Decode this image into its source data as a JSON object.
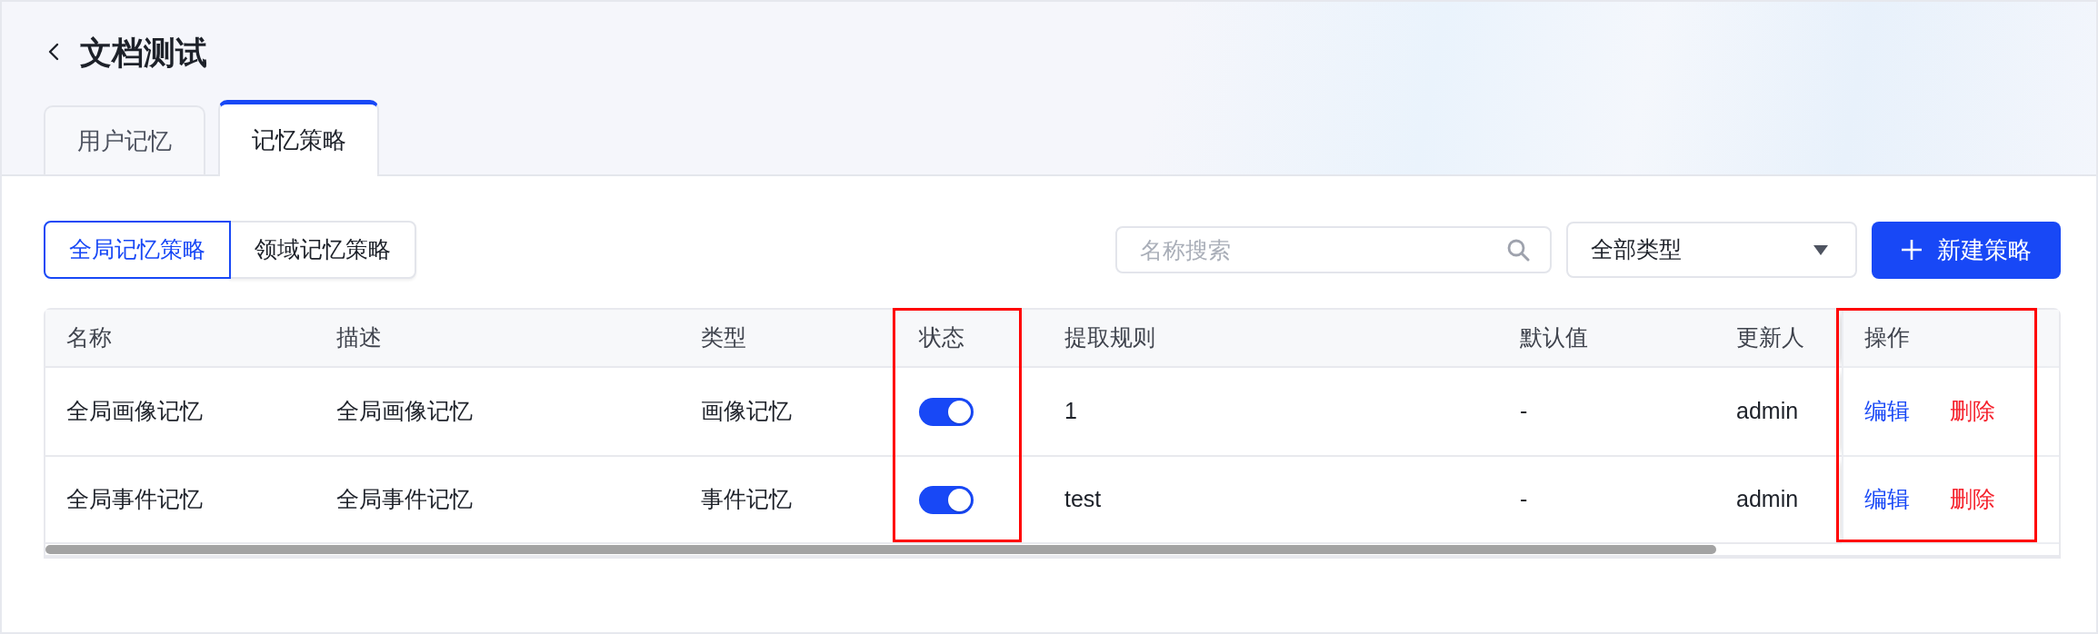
{
  "header": {
    "title": "文档测试"
  },
  "tabs": [
    {
      "label": "用户记忆",
      "selected": false
    },
    {
      "label": "记忆策略",
      "selected": true
    }
  ],
  "scope_switch": [
    {
      "label": "全局记忆策略",
      "selected": true
    },
    {
      "label": "领域记忆策略",
      "selected": false
    }
  ],
  "search": {
    "placeholder": "名称搜索"
  },
  "type_filter": {
    "value": "全部类型"
  },
  "new_button": {
    "label": "新建策略"
  },
  "table": {
    "columns": [
      {
        "label": "名称",
        "highlighted": false
      },
      {
        "label": "描述",
        "highlighted": false
      },
      {
        "label": "类型",
        "highlighted": false
      },
      {
        "label": "状态",
        "highlighted": true
      },
      {
        "label": "提取规则",
        "highlighted": false
      },
      {
        "label": "默认值",
        "highlighted": false
      },
      {
        "label": "更新人",
        "highlighted": false
      },
      {
        "label": "操作",
        "highlighted": true
      }
    ],
    "rows": [
      {
        "cells": [
          {
            "kind": "text",
            "text": "全局画像记忆"
          },
          {
            "kind": "text",
            "text": "全局画像记忆"
          },
          {
            "kind": "text",
            "text": "画像记忆"
          },
          {
            "kind": "switch",
            "on": true
          },
          {
            "kind": "text",
            "text": "1"
          },
          {
            "kind": "text",
            "text": "-"
          },
          {
            "kind": "text",
            "text": "admin"
          },
          {
            "kind": "actions",
            "actions": [
              {
                "kind": "edit",
                "label": "编辑"
              },
              {
                "kind": "delete",
                "label": "删除"
              }
            ]
          }
        ]
      },
      {
        "cells": [
          {
            "kind": "text",
            "text": "全局事件记忆"
          },
          {
            "kind": "text",
            "text": "全局事件记忆"
          },
          {
            "kind": "text",
            "text": "事件记忆"
          },
          {
            "kind": "switch",
            "on": true
          },
          {
            "kind": "text",
            "text": "test"
          },
          {
            "kind": "text",
            "text": "-"
          },
          {
            "kind": "text",
            "text": "admin"
          },
          {
            "kind": "actions",
            "actions": [
              {
                "kind": "edit",
                "label": "编辑"
              },
              {
                "kind": "delete",
                "label": "删除"
              }
            ]
          }
        ]
      }
    ]
  }
}
